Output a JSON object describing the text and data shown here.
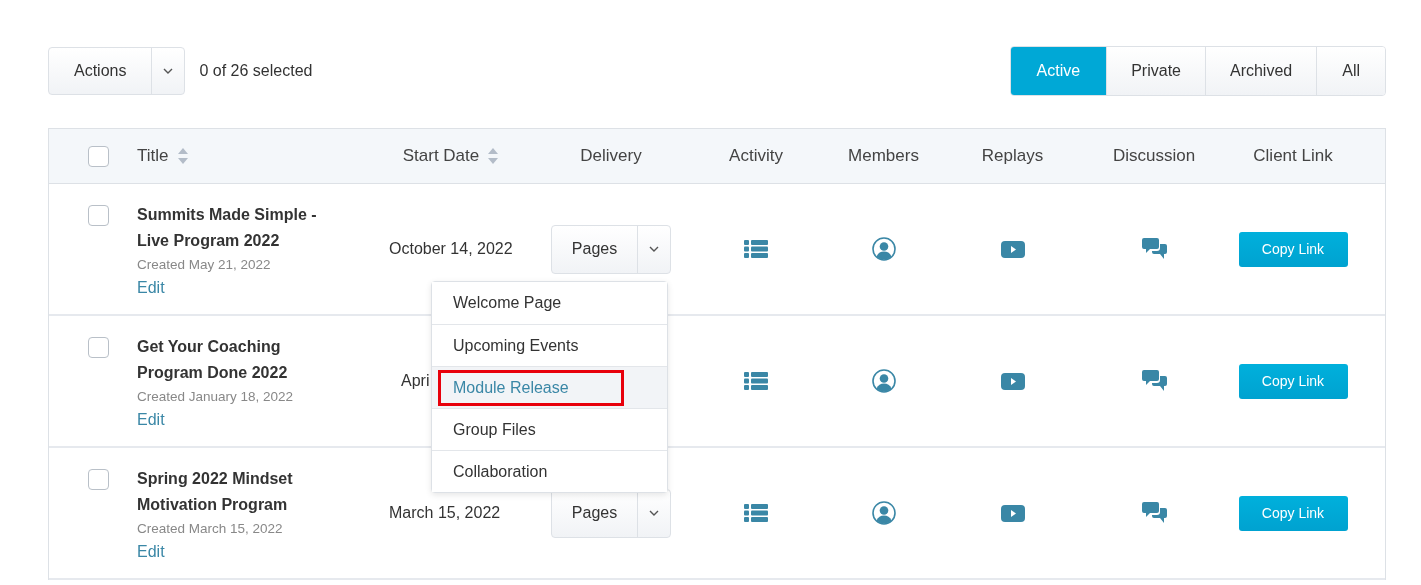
{
  "toolbar": {
    "actions_button": "Actions",
    "selection_count": "0 of 26 selected"
  },
  "filter_tabs": [
    {
      "label": "Active",
      "selected": true
    },
    {
      "label": "Private",
      "selected": false
    },
    {
      "label": "Archived",
      "selected": false
    },
    {
      "label": "All",
      "selected": false
    }
  ],
  "table": {
    "select_all_checked": false,
    "columns": [
      {
        "label": "Title",
        "sortable": true
      },
      {
        "label": "Start Date",
        "sortable": true
      },
      {
        "label": "Delivery",
        "sortable": false
      },
      {
        "label": "Activity",
        "sortable": false
      },
      {
        "label": "Members",
        "sortable": false
      },
      {
        "label": "Replays",
        "sortable": false
      },
      {
        "label": "Discussion",
        "sortable": false
      },
      {
        "label": "Client Link",
        "sortable": false
      }
    ],
    "rows": [
      {
        "checked": false,
        "title": "Summits Made Simple - Live Program 2022",
        "created": "Created May 21, 2022",
        "edit": "Edit",
        "start_date": "October 14, 2022",
        "delivery": "Pages",
        "copy_link": "Copy Link"
      },
      {
        "checked": false,
        "title": "Get Your Coaching Program Done 2022",
        "created": "Created January 18, 2022",
        "edit": "Edit",
        "start_date": "Apri",
        "copy_link": "Copy Link"
      },
      {
        "checked": false,
        "title": "Spring 2022 Mindset Motivation Program",
        "created": "Created March 15, 2022",
        "edit": "Edit",
        "start_date": "March 15, 2022",
        "delivery": "Pages",
        "copy_link": "Copy Link"
      }
    ]
  },
  "delivery_menu": [
    {
      "label": "Welcome Page",
      "selected": false
    },
    {
      "label": "Upcoming Events",
      "selected": false
    },
    {
      "label": "Module Release",
      "selected": true
    },
    {
      "label": "Group Files",
      "selected": false
    },
    {
      "label": "Collaboration",
      "selected": false
    }
  ]
}
